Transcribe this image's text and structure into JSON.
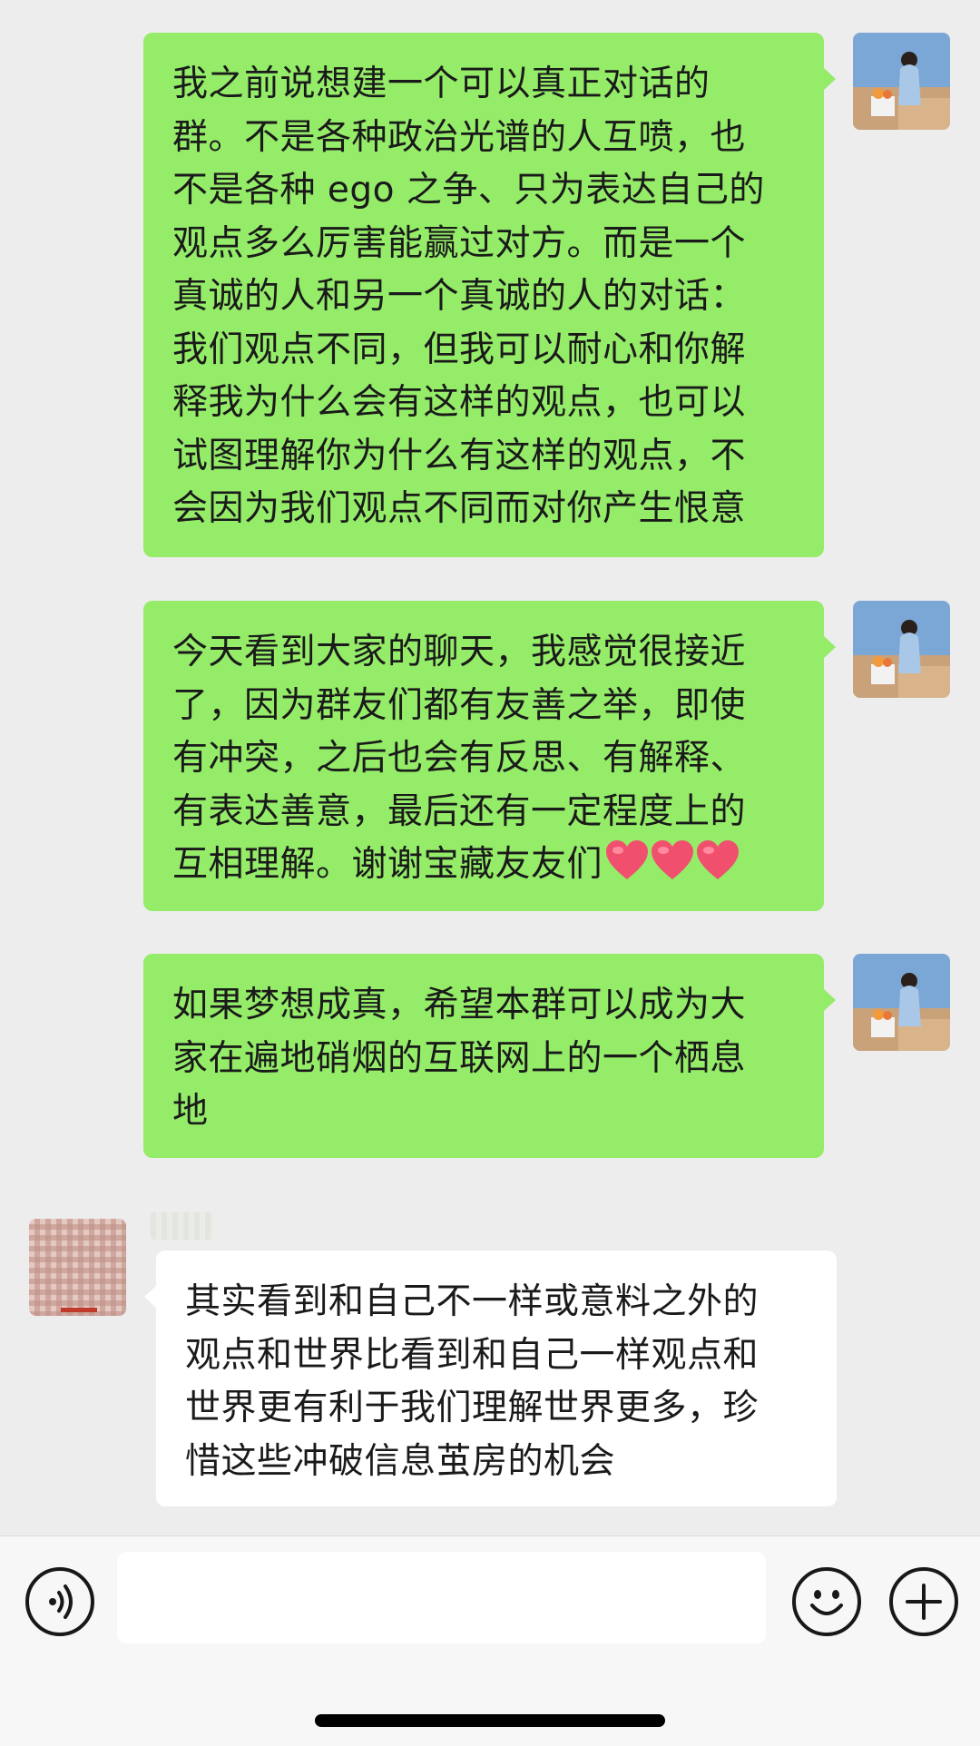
{
  "messages": [
    {
      "direction": "sent",
      "lines": [
        "我之前说想建一个可以真正对话的",
        "群。不是各种政治光谱的人互喷，也",
        "不是各种 ego 之争、只为表达自己的",
        "观点多么厉害能赢过对方。而是一个",
        "真诚的人和另一个真诚的人的对话：",
        "我们观点不同，但我可以耐心和你解",
        "释我为什么会有这样的观点，也可以",
        "试图理解你为什么有这样的观点，不",
        "会因为我们观点不同而对你产生恨意"
      ]
    },
    {
      "direction": "sent",
      "lines": [
        "今天看到大家的聊天，我感觉很接近",
        "了，因为群友们都有友善之举，即使",
        "有冲突，之后也会有反思、有解释、",
        "有表达善意，最后还有一定程度上的",
        "互相理解。谢谢宝藏友友们"
      ],
      "trailing_icons": [
        "heart-icon",
        "heart-icon",
        "heart-icon"
      ]
    },
    {
      "direction": "sent",
      "lines": [
        "如果梦想成真，希望本群可以成为大",
        "家在遍地硝烟的互联网上的一个栖息",
        "地"
      ]
    },
    {
      "direction": "received",
      "lines": [
        "其实看到和自己不一样或意料之外的",
        "观点和世界比看到和自己一样观点和",
        "世界更有利于我们理解世界更多，珍",
        "惜这些冲破信息茧房的机会"
      ]
    }
  ],
  "input_bar": {
    "voice_icon": "voice-icon",
    "emoji_icon": "emoji-icon",
    "plus_icon": "plus-icon",
    "message_value": ""
  },
  "colors": {
    "sent_bubble": "#95ec69",
    "received_bubble": "#ffffff",
    "chat_background": "#ededed",
    "input_bar_background": "#f7f7f7"
  }
}
